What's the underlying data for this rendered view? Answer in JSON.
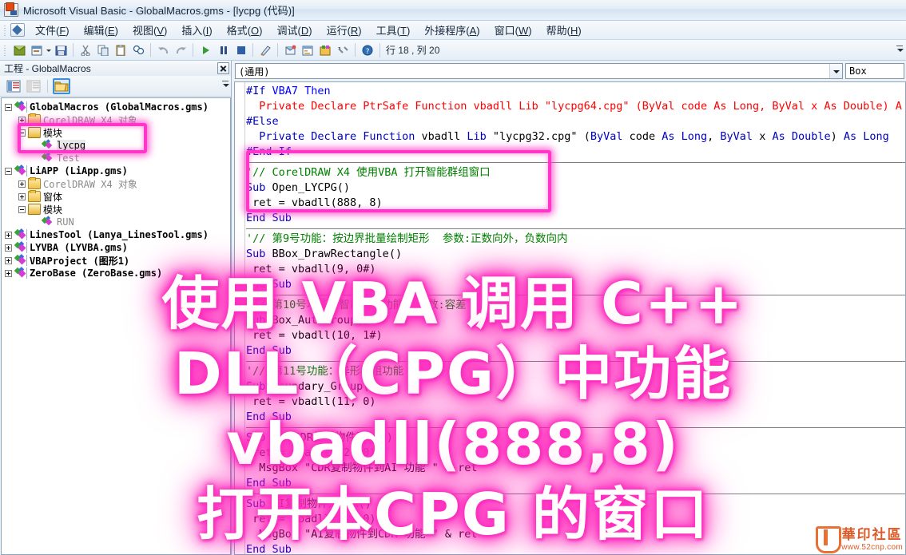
{
  "window": {
    "title": "Microsoft Visual Basic - GlobalMacros.gms - [lycpg (代码)]",
    "app_icon": "vb-app-icon"
  },
  "menubar": {
    "items": [
      {
        "label": "文件(F)"
      },
      {
        "label": "编辑(E)"
      },
      {
        "label": "视图(V)"
      },
      {
        "label": "插入(I)"
      },
      {
        "label": "格式(O)"
      },
      {
        "label": "调试(D)"
      },
      {
        "label": "运行(R)"
      },
      {
        "label": "工具(T)"
      },
      {
        "label": "外接程序(A)"
      },
      {
        "label": "窗口(W)"
      },
      {
        "label": "帮助(H)"
      }
    ]
  },
  "toolbar": {
    "buttons": [
      {
        "name": "view-coreldraw-icon"
      },
      {
        "name": "insert-userform-icon"
      },
      {
        "name": "save-icon"
      },
      {
        "name": "cut-icon"
      },
      {
        "name": "copy-icon"
      },
      {
        "name": "paste-icon"
      },
      {
        "name": "find-icon"
      },
      {
        "name": "undo-icon"
      },
      {
        "name": "redo-icon"
      },
      {
        "name": "run-icon"
      },
      {
        "name": "break-icon"
      },
      {
        "name": "reset-icon"
      },
      {
        "name": "design-mode-icon"
      },
      {
        "name": "project-explorer-icon"
      },
      {
        "name": "properties-window-icon"
      },
      {
        "name": "object-browser-icon"
      },
      {
        "name": "toolbox-icon"
      },
      {
        "name": "help-icon"
      }
    ],
    "position_label": "行 18 , 列 20"
  },
  "project_panel": {
    "title": "工程 - GlobalMacros",
    "close_label": "×",
    "toolbar": [
      {
        "name": "view-code-button"
      },
      {
        "name": "view-object-button"
      },
      {
        "name": "toggle-folders-button"
      }
    ],
    "tree": [
      {
        "indent": 0,
        "expander": "minus",
        "icon": "project",
        "label": "GlobalMacros  (GlobalMacros.gms)",
        "style": "bold"
      },
      {
        "indent": 1,
        "expander": "plus",
        "icon": "folder",
        "label": "CorelDRAW X4 对象",
        "style": "grey"
      },
      {
        "indent": 1,
        "expander": "minus",
        "icon": "folderopen",
        "label": "模块",
        "style": "normal"
      },
      {
        "indent": 2,
        "expander": "none",
        "icon": "module",
        "label": "lycpg",
        "style": "selected"
      },
      {
        "indent": 2,
        "expander": "none",
        "icon": "module",
        "label": "Test",
        "style": "grey"
      },
      {
        "indent": 0,
        "expander": "minus",
        "icon": "project",
        "label": "LiAPP  (LiApp.gms)",
        "style": "bold"
      },
      {
        "indent": 1,
        "expander": "plus",
        "icon": "folder",
        "label": "CorelDRAW X4 对象",
        "style": "grey"
      },
      {
        "indent": 1,
        "expander": "plus",
        "icon": "folder",
        "label": "窗体",
        "style": "normal"
      },
      {
        "indent": 1,
        "expander": "minus",
        "icon": "folderopen",
        "label": "模块",
        "style": "normal"
      },
      {
        "indent": 2,
        "expander": "none",
        "icon": "module",
        "label": "RUN",
        "style": "grey"
      },
      {
        "indent": 0,
        "expander": "plus",
        "icon": "project",
        "label": "LinesTool  (Lanya_LinesTool.gms)",
        "style": "bold"
      },
      {
        "indent": 0,
        "expander": "plus",
        "icon": "project",
        "label": "LYVBA  (LYVBA.gms)",
        "style": "bold"
      },
      {
        "indent": 0,
        "expander": "plus",
        "icon": "project",
        "label": "VBAProject  (图形1)",
        "style": "bold"
      },
      {
        "indent": 0,
        "expander": "plus",
        "icon": "project",
        "label": "ZeroBase  (ZeroBase.gms)",
        "style": "bold"
      }
    ]
  },
  "code_window": {
    "object_combo": "(通用)",
    "procedure_combo": "Box",
    "lines": [
      {
        "segments": [
          {
            "t": "#If ",
            "c": "kw"
          },
          {
            "t": "VBA7 ",
            "c": "kw2"
          },
          {
            "t": "Then",
            "c": "kw2"
          }
        ]
      },
      {
        "segments": [
          {
            "t": "  Private Declare PtrSafe Function vbadll Lib \"lycpg64.cpg\" (ByVal code As Long, ByVal x As Double) A",
            "c": "err"
          }
        ]
      },
      {
        "segments": [
          {
            "t": "#Else",
            "c": "kw"
          }
        ]
      },
      {
        "segments": [
          {
            "t": "  ",
            "c": "pl"
          },
          {
            "t": "Private Declare Function ",
            "c": "kw"
          },
          {
            "t": "vbadll ",
            "c": "pl"
          },
          {
            "t": "Lib ",
            "c": "kw"
          },
          {
            "t": "\"lycpg32.cpg\" ",
            "c": "pl"
          },
          {
            "t": "(",
            "c": "pl"
          },
          {
            "t": "ByVal ",
            "c": "kw"
          },
          {
            "t": "code ",
            "c": "pl"
          },
          {
            "t": "As Long",
            "c": "kw"
          },
          {
            "t": ", ",
            "c": "pl"
          },
          {
            "t": "ByVal ",
            "c": "kw"
          },
          {
            "t": "x ",
            "c": "pl"
          },
          {
            "t": "As Double",
            "c": "kw"
          },
          {
            "t": ") ",
            "c": "pl"
          },
          {
            "t": "As Long",
            "c": "kw"
          }
        ]
      },
      {
        "segments": [
          {
            "t": "#End If",
            "c": "kw"
          }
        ]
      },
      {
        "divider": true
      },
      {
        "segments": [
          {
            "t": "'// CorelDRAW X4 使用VBA 打开智能群组窗口",
            "c": "cm"
          }
        ]
      },
      {
        "segments": [
          {
            "t": "Sub ",
            "c": "kw"
          },
          {
            "t": "Open_LYCPG()",
            "c": "pl"
          }
        ]
      },
      {
        "segments": [
          {
            "t": " ret = vbadll(888, 8)",
            "c": "pl"
          }
        ]
      },
      {
        "segments": [
          {
            "t": "End Sub",
            "c": "kw"
          }
        ]
      },
      {
        "divider": true
      },
      {
        "segments": [
          {
            "t": "'// 第9号功能：按边界批量绘制矩形  参数:正数向外，负数向内",
            "c": "cm"
          }
        ]
      },
      {
        "segments": [
          {
            "t": "Sub ",
            "c": "kw"
          },
          {
            "t": "BBox_DrawRectangle()",
            "c": "pl"
          }
        ]
      },
      {
        "segments": [
          {
            "t": " ret = vbadll(9, 0#)",
            "c": "pl"
          }
        ]
      },
      {
        "segments": [
          {
            "t": "End Sub",
            "c": "kw"
          }
        ]
      },
      {
        "divider": true
      },
      {
        "segments": [
          {
            "t": "'// 第10号功能：智能群组功能  参数:容差",
            "c": "cm"
          }
        ]
      },
      {
        "segments": [
          {
            "t": "Sub ",
            "c": "kw"
          },
          {
            "t": "Box_AutoGroup()",
            "c": "pl"
          }
        ]
      },
      {
        "segments": [
          {
            "t": " ret = vbadll(10, 1#)",
            "c": "pl"
          }
        ]
      },
      {
        "segments": [
          {
            "t": "End Sub",
            "c": "kw"
          }
        ]
      },
      {
        "divider": true
      },
      {
        "segments": [
          {
            "t": "'// 第11号功能：异形群组功能",
            "c": "cm"
          }
        ]
      },
      {
        "segments": [
          {
            "t": "Sub ",
            "c": "kw"
          },
          {
            "t": "Boundary_Group()",
            "c": "pl"
          }
        ]
      },
      {
        "segments": [
          {
            "t": " ret = vbadll(11, 0)",
            "c": "pl"
          }
        ]
      },
      {
        "segments": [
          {
            "t": "End Sub",
            "c": "kw"
          }
        ]
      },
      {
        "divider": true
      },
      {
        "segments": [
          {
            "t": "Sub ",
            "c": "kw"
          },
          {
            "t": "调用CDR复制物件到AI()",
            "c": "pl"
          }
        ]
      },
      {
        "segments": [
          {
            "t": " ret = vbadll(12, 0)",
            "c": "pl"
          }
        ]
      },
      {
        "segments": [
          {
            "t": "  MsgBox \"CDR复制物件到AI 功能 \" & ret",
            "c": "pl"
          }
        ]
      },
      {
        "segments": [
          {
            "t": "End Sub",
            "c": "kw"
          }
        ]
      },
      {
        "divider": true
      },
      {
        "segments": [
          {
            "t": "Sub ",
            "c": "kw"
          },
          {
            "t": "AI复制物件到CDR()",
            "c": "pl"
          }
        ]
      },
      {
        "segments": [
          {
            "t": " ret = vbadll(13, 0)",
            "c": "pl"
          }
        ]
      },
      {
        "segments": [
          {
            "t": "  MsgBox \"AI复制物件到CDR 功能 \" & ret",
            "c": "pl"
          }
        ]
      },
      {
        "segments": [
          {
            "t": "End Sub",
            "c": "kw"
          }
        ]
      },
      {
        "divider": true
      }
    ]
  },
  "overlay": {
    "lines": [
      "使用 VBA 调用 C++",
      "DLL（CPG）中功能",
      "vbadll(888,8)",
      "打开本CPG 的窗口"
    ]
  },
  "watermark": {
    "name": "華印社區",
    "url": "www.52cnp.com"
  },
  "colors": {
    "highlight": "#ff36c8",
    "keyword": "#0000c0",
    "comment": "#008000",
    "error": "#ff0000",
    "accent": "#3c8fd6"
  }
}
